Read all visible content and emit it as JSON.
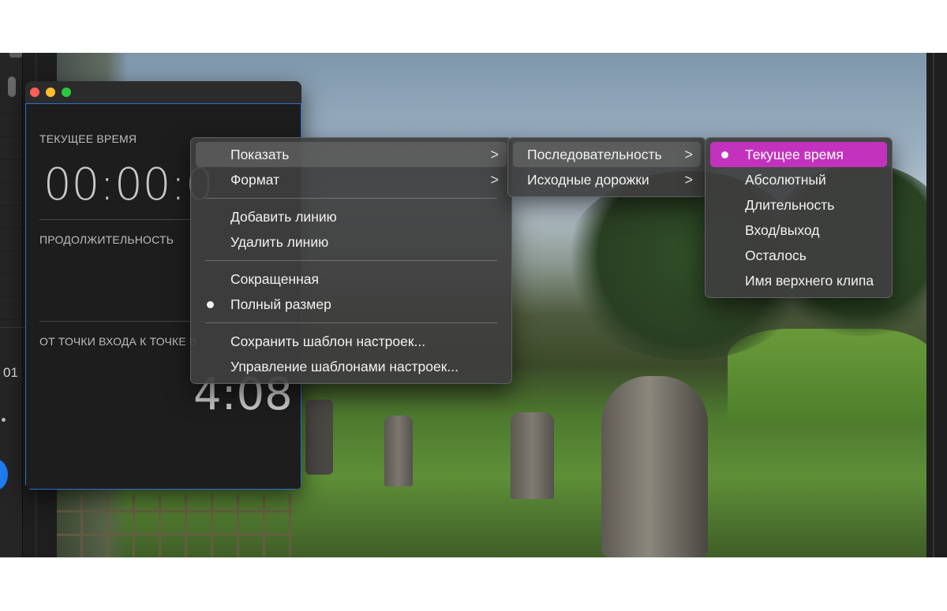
{
  "timecode_window": {
    "current_time_label": "ТЕКУЩЕЕ ВРЕМЯ",
    "current_time_value": "00:00:0",
    "duration_label": "ПРОДОЛЖИТЕЛЬНОСТЬ",
    "in_out_label": "ОТ ТОЧКИ ВХОДА К ТОЧКЕ В",
    "in_out_value": "4:08"
  },
  "left_panel": {
    "timecode_fragment": "01"
  },
  "context_menu": {
    "items": [
      {
        "label": "Показать",
        "has_submenu": true
      },
      {
        "label": "Формат",
        "has_submenu": true
      },
      {
        "label": "Добавить линию"
      },
      {
        "label": "Удалить линию"
      },
      {
        "label": "Сокращенная"
      },
      {
        "label": "Полный размер",
        "checked": true
      },
      {
        "label": "Сохранить шаблон настроек..."
      },
      {
        "label": "Управление шаблонами настроек..."
      }
    ]
  },
  "submenu_show": {
    "items": [
      {
        "label": "Последовательность",
        "has_submenu": true
      },
      {
        "label": "Исходные дорожки",
        "has_submenu": true
      }
    ]
  },
  "submenu_sequence": {
    "items": [
      {
        "label": "Текущее время",
        "checked": true
      },
      {
        "label": "Абсолютный"
      },
      {
        "label": "Длительность"
      },
      {
        "label": "Вход/выход"
      },
      {
        "label": "Осталось"
      },
      {
        "label": "Имя верхнего клипа"
      }
    ]
  },
  "colors": {
    "highlight": "#c232bd",
    "focus_border": "#2f6fd0"
  },
  "icons": {
    "submenu_arrow": "chevron-right-icon",
    "checkmark": "bullet-dot-icon"
  }
}
